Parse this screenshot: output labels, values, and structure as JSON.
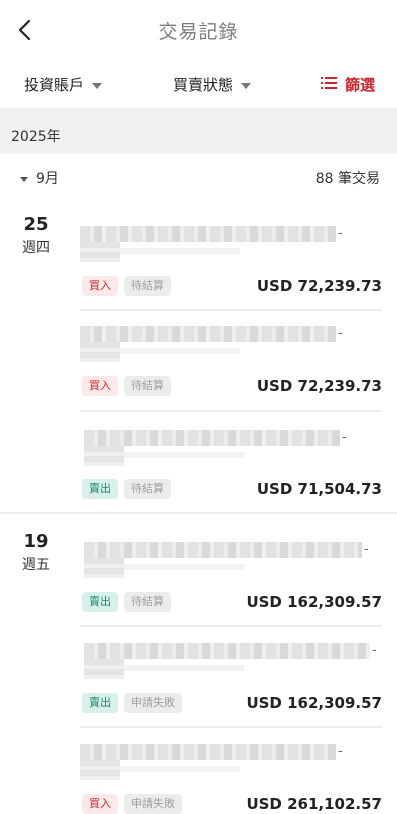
{
  "header": {
    "title": "交易記錄",
    "back_icon": "chevron-left-icon"
  },
  "filters": {
    "account": "投資賬戶",
    "status": "買賣狀態",
    "filter": "篩選",
    "accent_color": "#d0232b"
  },
  "year": "2025年",
  "month": {
    "label": "9月",
    "count": "88 筆交易"
  },
  "groups": [
    {
      "day": "25",
      "weekday": "週四",
      "transactions": [
        {
          "side": "買入",
          "status": "待結算",
          "amount": "USD 72,239.73",
          "dash": "-"
        },
        {
          "side": "買入",
          "status": "待結算",
          "amount": "USD 72,239.73",
          "dash": "-"
        },
        {
          "side": "賣出",
          "status": "待結算",
          "amount": "USD 71,504.73",
          "dash": "-"
        }
      ]
    },
    {
      "day": "19",
      "weekday": "週五",
      "transactions": [
        {
          "side": "賣出",
          "status": "待結算",
          "amount": "USD 162,309.57",
          "dash": "-"
        },
        {
          "side": "賣出",
          "status": "申請失敗",
          "amount": "USD 162,309.57",
          "dash": "-"
        },
        {
          "side": "買入",
          "status": "申請失敗",
          "amount": "USD 261,102.57",
          "dash": "-"
        }
      ]
    }
  ]
}
